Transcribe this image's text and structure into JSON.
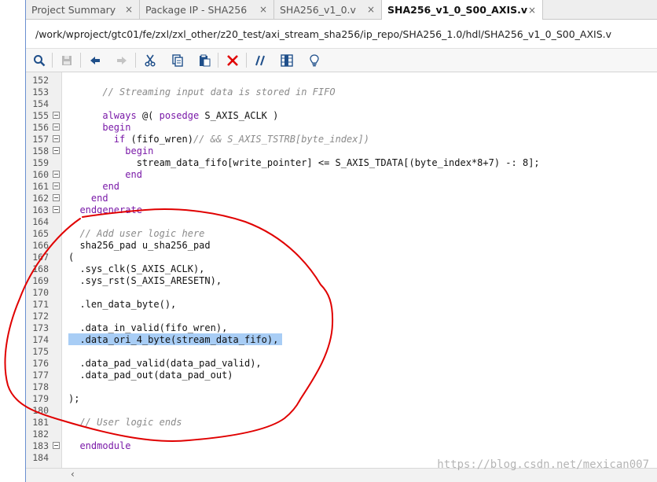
{
  "tabs": [
    {
      "label": "Project Summary",
      "active": false
    },
    {
      "label": "Package IP - SHA256",
      "active": false
    },
    {
      "label": "SHA256_v1_0.v",
      "active": false
    },
    {
      "label": "SHA256_v1_0_S00_AXIS.v",
      "active": true
    }
  ],
  "tab_close_glyph": "×",
  "path": "/work/wproject/gtc01/fe/zxl/zxl_other/z20_test/axi_stream_sha256/ip_repo/SHA256_1.0/hdl/SHA256_v1_0_S00_AXIS.v",
  "toolbar": [
    {
      "name": "search-icon",
      "enabled": true
    },
    {
      "name": "save-icon",
      "enabled": false
    },
    {
      "name": "undo-icon",
      "enabled": true
    },
    {
      "name": "redo-icon",
      "enabled": false
    },
    {
      "name": "cut-icon",
      "enabled": true
    },
    {
      "name": "copy-icon",
      "enabled": true
    },
    {
      "name": "paste-icon",
      "enabled": true
    },
    {
      "name": "delete-icon",
      "enabled": true
    },
    {
      "name": "comment-icon",
      "enabled": true
    },
    {
      "name": "column-mode-icon",
      "enabled": true
    },
    {
      "name": "lightbulb-icon",
      "enabled": true
    }
  ],
  "colors": {
    "keyword": "#7a1aa8",
    "comment": "#8a8a8a",
    "selection": "#a8cdf5",
    "annotation": "#e00000",
    "delete": "#e00000",
    "toolbar_icon": "#1f4f8a"
  },
  "code_lines": [
    {
      "num": "152",
      "fold": false,
      "text": ""
    },
    {
      "num": "153",
      "fold": false,
      "text": "      // Streaming input data is stored in FIFO"
    },
    {
      "num": "154",
      "fold": false,
      "text": ""
    },
    {
      "num": "155",
      "fold": true,
      "text": "      always @( posedge S_AXIS_ACLK )"
    },
    {
      "num": "156",
      "fold": true,
      "text": "      begin"
    },
    {
      "num": "157",
      "fold": true,
      "text": "        if (fifo_wren)// && S_AXIS_TSTRB[byte_index])"
    },
    {
      "num": "158",
      "fold": true,
      "text": "          begin"
    },
    {
      "num": "159",
      "fold": false,
      "text": "            stream_data_fifo[write_pointer] <= S_AXIS_TDATA[(byte_index*8+7) -: 8];"
    },
    {
      "num": "160",
      "fold": true,
      "text": "          end"
    },
    {
      "num": "161",
      "fold": true,
      "text": "      end"
    },
    {
      "num": "162",
      "fold": true,
      "text": "    end"
    },
    {
      "num": "163",
      "fold": true,
      "text": "  endgenerate"
    },
    {
      "num": "164",
      "fold": false,
      "text": ""
    },
    {
      "num": "165",
      "fold": false,
      "text": "  // Add user logic here"
    },
    {
      "num": "166",
      "fold": false,
      "text": "  sha256_pad u_sha256_pad"
    },
    {
      "num": "167",
      "fold": false,
      "text": "("
    },
    {
      "num": "168",
      "fold": false,
      "text": "  .sys_clk(S_AXIS_ACLK),"
    },
    {
      "num": "169",
      "fold": false,
      "text": "  .sys_rst(S_AXIS_ARESETN),"
    },
    {
      "num": "170",
      "fold": false,
      "text": ""
    },
    {
      "num": "171",
      "fold": false,
      "text": "  .len_data_byte(),"
    },
    {
      "num": "172",
      "fold": false,
      "text": ""
    },
    {
      "num": "173",
      "fold": false,
      "text": "  .data_in_valid(fifo_wren),"
    },
    {
      "num": "174",
      "fold": false,
      "text": "  .data_ori_4_byte(stream_data_fifo),",
      "selected": true
    },
    {
      "num": "175",
      "fold": false,
      "text": ""
    },
    {
      "num": "176",
      "fold": false,
      "text": "  .data_pad_valid(data_pad_valid),"
    },
    {
      "num": "177",
      "fold": false,
      "text": "  .data_pad_out(data_pad_out)"
    },
    {
      "num": "178",
      "fold": false,
      "text": ""
    },
    {
      "num": "179",
      "fold": false,
      "text": ");"
    },
    {
      "num": "180",
      "fold": false,
      "text": ""
    },
    {
      "num": "181",
      "fold": false,
      "text": "  // User logic ends"
    },
    {
      "num": "182",
      "fold": false,
      "text": ""
    },
    {
      "num": "183",
      "fold": true,
      "text": "  endmodule"
    },
    {
      "num": "184",
      "fold": false,
      "text": ""
    }
  ],
  "keywords": [
    "always",
    "posedge",
    "begin",
    "if",
    "end",
    "endgenerate",
    "endmodule"
  ],
  "scroll_arrow": "‹",
  "watermark": "https://blog.csdn.net/mexican007"
}
